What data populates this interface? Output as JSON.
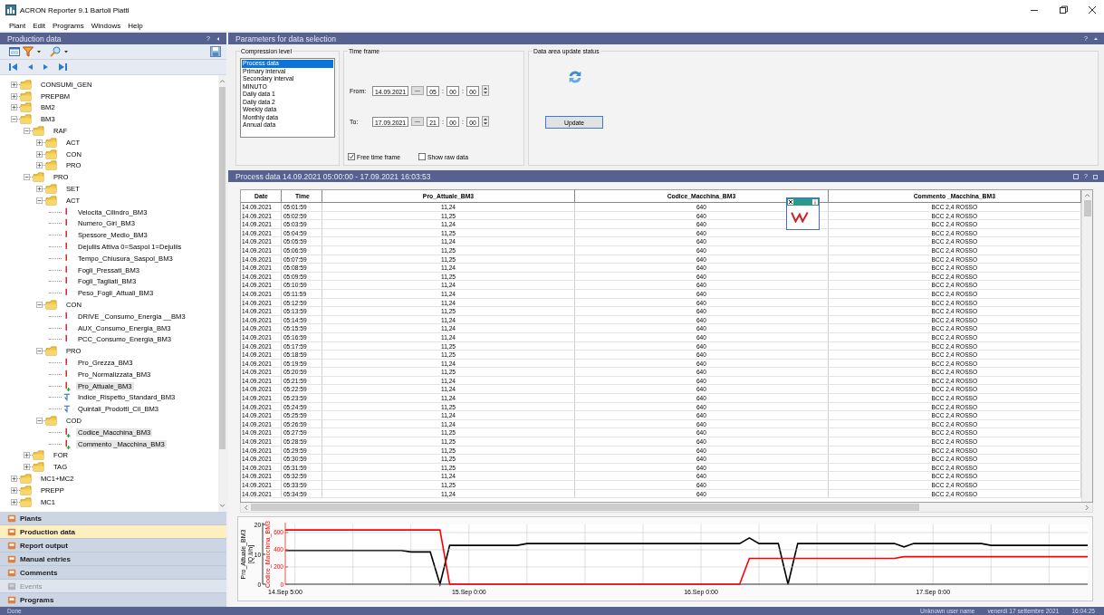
{
  "window": {
    "title": "ACRON  Reporter 9.1 Bartoli Piatti"
  },
  "menu": [
    "Plant",
    "Edit",
    "Programs",
    "Windows",
    "Help"
  ],
  "left_panel": {
    "title": "Production data",
    "help": "?",
    "tree": [
      {
        "label": "CONSUMI_GEN",
        "kind": "folder",
        "expanded": false,
        "selected": false
      },
      {
        "label": "PREPBM",
        "kind": "folder",
        "expanded": false,
        "selected": false
      },
      {
        "label": "BM2",
        "kind": "folder",
        "expanded": false,
        "selected": false
      },
      {
        "label": "BM3",
        "kind": "folder",
        "expanded": true,
        "selected": false,
        "children": [
          {
            "label": "RAF",
            "kind": "folder",
            "expanded": true,
            "selected": false,
            "children": [
              {
                "label": "ACT",
                "kind": "folder",
                "expanded": false,
                "selected": false
              },
              {
                "label": "CON",
                "kind": "folder",
                "expanded": false,
                "selected": false
              },
              {
                "label": "PRO",
                "kind": "folder",
                "expanded": false,
                "selected": false
              }
            ]
          },
          {
            "label": "PRO",
            "kind": "folder",
            "expanded": true,
            "selected": false,
            "children": [
              {
                "label": "SET",
                "kind": "folder",
                "expanded": false,
                "selected": false
              },
              {
                "label": "ACT",
                "kind": "folder",
                "expanded": true,
                "selected": false,
                "children": [
                  {
                    "label": "Velocita_Cilindro_BM3",
                    "kind": "signal",
                    "selected": false
                  },
                  {
                    "label": "Numero_Giri_BM3",
                    "kind": "signal",
                    "selected": false
                  },
                  {
                    "label": "Spessore_Medio_BM3",
                    "kind": "signal",
                    "selected": false
                  },
                  {
                    "label": "Dejuliis Attiva 0=Saspol 1=Dejuliis",
                    "kind": "signal",
                    "selected": false
                  },
                  {
                    "label": "Tempo_Chiusura_Saspol_BM3",
                    "kind": "signal",
                    "selected": false
                  },
                  {
                    "label": "Fogli_Pressati_BM3",
                    "kind": "signal",
                    "selected": false
                  },
                  {
                    "label": "Fogli_Tagliati_BM3",
                    "kind": "signal",
                    "selected": false
                  },
                  {
                    "label": "Peso_Fogli_Attuali_BM3",
                    "kind": "signal",
                    "selected": false
                  }
                ]
              },
              {
                "label": "CON",
                "kind": "folder",
                "expanded": true,
                "selected": false,
                "children": [
                  {
                    "label": "DRIVE _Consumo_Energia __BM3",
                    "kind": "signal",
                    "selected": false
                  },
                  {
                    "label": "AUX_Consumo_Energia_BM3",
                    "kind": "signal",
                    "selected": false
                  },
                  {
                    "label": "PCC_Consumo_Energia_BM3",
                    "kind": "signal",
                    "selected": false
                  }
                ]
              },
              {
                "label": "PRO",
                "kind": "folder",
                "expanded": true,
                "selected": false,
                "children": [
                  {
                    "label": "Pro_Grezza_BM3",
                    "kind": "signal",
                    "selected": false
                  },
                  {
                    "label": "Pro_Normalizzata_BM3",
                    "kind": "signal",
                    "selected": false
                  },
                  {
                    "label": "Pro_Attuale_BM3",
                    "kind": "signal",
                    "selected": true
                  },
                  {
                    "label": "Indice_Rispetto_Standard_BM3",
                    "kind": "formula",
                    "selected": false
                  },
                  {
                    "label": "Quintali_Prodotti_Cil_BM3",
                    "kind": "formula",
                    "selected": false
                  }
                ]
              },
              {
                "label": "COD",
                "kind": "folder",
                "expanded": true,
                "selected": false,
                "children": [
                  {
                    "label": "Codice_Macchina_BM3",
                    "kind": "signal",
                    "selected": true
                  },
                  {
                    "label": "Commento _Macchina_BM3",
                    "kind": "signal",
                    "selected": true
                  }
                ]
              }
            ]
          },
          {
            "label": "FOR",
            "kind": "folder",
            "expanded": false,
            "selected": false
          },
          {
            "label": "TAG",
            "kind": "folder",
            "expanded": false,
            "selected": false
          }
        ]
      },
      {
        "label": "MC1+MC2",
        "kind": "folder",
        "expanded": false,
        "selected": false
      },
      {
        "label": "PREPP",
        "kind": "folder",
        "expanded": false,
        "selected": false
      },
      {
        "label": "MC1",
        "kind": "folder",
        "expanded": false,
        "selected": false
      }
    ],
    "nav": [
      {
        "label": "Plants",
        "selected": false,
        "disabled": false
      },
      {
        "label": "Production data",
        "selected": true,
        "disabled": false
      },
      {
        "label": "Report output",
        "selected": false,
        "disabled": false
      },
      {
        "label": "Manual entries",
        "selected": false,
        "disabled": false
      },
      {
        "label": "Comments",
        "selected": false,
        "disabled": false
      },
      {
        "label": "Events",
        "selected": false,
        "disabled": true
      },
      {
        "label": "Programs",
        "selected": false,
        "disabled": false
      }
    ]
  },
  "parameters": {
    "title": "Parameters for data selection",
    "help": "?",
    "compression": {
      "legend": "Compression level",
      "options": [
        {
          "label": "Process data",
          "selected": true
        },
        {
          "label": "Primary interval",
          "selected": false
        },
        {
          "label": "Secondary interval",
          "selected": false
        },
        {
          "label": "MINUTO",
          "selected": false
        },
        {
          "label": "Daily data 1",
          "selected": false
        },
        {
          "label": "Daily data 2",
          "selected": false
        },
        {
          "label": "Weekly data",
          "selected": false
        },
        {
          "label": "Monthly data",
          "selected": false
        },
        {
          "label": "Annual data",
          "selected": false
        }
      ]
    },
    "time_frame": {
      "legend": "Time frame",
      "ranges": [
        {
          "label": "From:",
          "date": "14.09.2021",
          "browse": "---",
          "hh": "05",
          "mm": "00",
          "ss": "00",
          "separator": ":"
        },
        {
          "label": "To:",
          "date": "17.09.2021",
          "browse": "---",
          "hh": "21",
          "mm": "00",
          "ss": "00",
          "separator": ":"
        }
      ],
      "options": [
        {
          "label": "Free time frame",
          "checked": true
        },
        {
          "label": "Show raw data",
          "checked": false
        }
      ]
    },
    "update_status": {
      "legend": "Data area update status",
      "button": "Update"
    }
  },
  "process_data": {
    "title": "Process data  14.09.2021 05:00:00 - 17.09.2021 16:03:53",
    "columns": [
      "Date",
      "Time",
      "Pro_Attuale_BM3",
      "Codice_Macchina_BM3",
      "Commento _Macchina_BM3"
    ],
    "rows": [
      [
        "14.09.2021",
        "05:01:59",
        "11,24",
        "640",
        "BCC 2,4 ROSSO"
      ],
      [
        "14.09.2021",
        "05:02:59",
        "11,25",
        "640",
        "BCC 2,4 ROSSO"
      ],
      [
        "14.09.2021",
        "05:03:59",
        "11,24",
        "640",
        "BCC 2,4 ROSSO"
      ],
      [
        "14.09.2021",
        "05:04:59",
        "11,25",
        "640",
        "BCC 2,4 ROSSO"
      ],
      [
        "14.09.2021",
        "05:05:59",
        "11,24",
        "640",
        "BCC 2,4 ROSSO"
      ],
      [
        "14.09.2021",
        "05:06:59",
        "11,25",
        "640",
        "BCC 2,4 ROSSO"
      ],
      [
        "14.09.2021",
        "05:07:59",
        "11,25",
        "640",
        "BCC 2,4 ROSSO"
      ],
      [
        "14.09.2021",
        "05:08:59",
        "11,24",
        "640",
        "BCC 2,4 ROSSO"
      ],
      [
        "14.09.2021",
        "05:09:59",
        "11,25",
        "640",
        "BCC 2,4 ROSSO"
      ],
      [
        "14.09.2021",
        "05:10:59",
        "11,24",
        "640",
        "BCC 2,4 ROSSO"
      ],
      [
        "14.09.2021",
        "05:11:59",
        "11,24",
        "640",
        "BCC 2,4 ROSSO"
      ],
      [
        "14.09.2021",
        "05:12:59",
        "11,24",
        "640",
        "BCC 2,4 ROSSO"
      ],
      [
        "14.09.2021",
        "05:13:59",
        "11,25",
        "640",
        "BCC 2,4 ROSSO"
      ],
      [
        "14.09.2021",
        "05:14:59",
        "11,24",
        "640",
        "BCC 2,4 ROSSO"
      ],
      [
        "14.09.2021",
        "05:15:59",
        "11,24",
        "640",
        "BCC 2,4 ROSSO"
      ],
      [
        "14.09.2021",
        "05:16:59",
        "11,24",
        "640",
        "BCC 2,4 ROSSO"
      ],
      [
        "14.09.2021",
        "05:17:59",
        "11,25",
        "640",
        "BCC 2,4 ROSSO"
      ],
      [
        "14.09.2021",
        "05:18:59",
        "11,25",
        "640",
        "BCC 2,4 ROSSO"
      ],
      [
        "14.09.2021",
        "05:19:59",
        "11,24",
        "640",
        "BCC 2,4 ROSSO"
      ],
      [
        "14.09.2021",
        "05:20:59",
        "11,25",
        "640",
        "BCC 2,4 ROSSO"
      ],
      [
        "14.09.2021",
        "05:21:59",
        "11,24",
        "640",
        "BCC 2,4 ROSSO"
      ],
      [
        "14.09.2021",
        "05:22:59",
        "11,24",
        "640",
        "BCC 2,4 ROSSO"
      ],
      [
        "14.09.2021",
        "05:23:59",
        "11,24",
        "640",
        "BCC 2,4 ROSSO"
      ],
      [
        "14.09.2021",
        "05:24:59",
        "11,25",
        "640",
        "BCC 2,4 ROSSO"
      ],
      [
        "14.09.2021",
        "05:25:59",
        "11,24",
        "640",
        "BCC 2,4 ROSSO"
      ],
      [
        "14.09.2021",
        "05:26:59",
        "11,24",
        "640",
        "BCC 2,4 ROSSO"
      ],
      [
        "14.09.2021",
        "05:27:59",
        "11,25",
        "640",
        "BCC 2,4 ROSSO"
      ],
      [
        "14.09.2021",
        "05:28:59",
        "11,25",
        "640",
        "BCC 2,4 ROSSO"
      ],
      [
        "14.09.2021",
        "05:29:59",
        "11,25",
        "640",
        "BCC 2,4 ROSSO"
      ],
      [
        "14.09.2021",
        "05:30:59",
        "11,25",
        "640",
        "BCC 2,4 ROSSO"
      ],
      [
        "14.09.2021",
        "05:31:59",
        "11,25",
        "640",
        "BCC 2,4 ROSSO"
      ],
      [
        "14.09.2021",
        "05:32:59",
        "11,24",
        "640",
        "BCC 2,4 ROSSO"
      ],
      [
        "14.09.2021",
        "05:33:59",
        "11,25",
        "640",
        "BCC 2,4 ROSSO"
      ],
      [
        "14.09.2021",
        "05:34:59",
        "11,24",
        "640",
        "BCC 2,4 ROSSO"
      ]
    ],
    "trends": [
      {
        "chart_data": {
          "type": "line",
          "grid": true,
          "categories": [
            "14.Sep 5:00",
            null,
            null,
            null,
            null,
            null,
            null,
            null,
            null,
            null,
            null,
            null,
            null,
            null,
            null,
            null,
            null,
            null,
            null,
            "15.Sep 0:00",
            null,
            null,
            null,
            null,
            null,
            null,
            null,
            null,
            null,
            null,
            null,
            null,
            null,
            null,
            null,
            null,
            null,
            null,
            null,
            null,
            null,
            null,
            null,
            "16.Sep 0:00",
            null,
            null,
            null,
            null,
            null,
            null,
            null,
            null,
            null,
            null,
            null,
            null,
            null,
            null,
            null,
            null,
            null,
            null,
            null,
            null,
            null,
            null,
            null,
            "17.Sep 0:00",
            null,
            null,
            null,
            null,
            null,
            null,
            null,
            null,
            null,
            null,
            null,
            null,
            null,
            null,
            null,
            null
          ],
          "ylim": [
            0,
            20
          ],
          "yticks": [
            0,
            10,
            20
          ],
          "series": [
            {
              "name": "Pro_Attuale_BM3 [Q.li/h]",
              "color": "#000000",
              "values": [
                11.3,
                11.3,
                11.3,
                11.3,
                11.3,
                11.3,
                11.3,
                11.3,
                11.3,
                11.3,
                11.3,
                11.3,
                11.3,
                10.8,
                10.8,
                10.8,
                0,
                13,
                13,
                13,
                13,
                13,
                13,
                13,
                13,
                13.6,
                13.6,
                13.6,
                13.6,
                13.6,
                13.6,
                13.6,
                13.6,
                13.6,
                13.6,
                13.6,
                13.6,
                13.6,
                13.6,
                13.6,
                13.6,
                13.6,
                13.6,
                13.6,
                13.6,
                13.6,
                13.6,
                13.6,
                15.5,
                13.6,
                13.6,
                13.6,
                0,
                13.6,
                13.6,
                13.6,
                13.6,
                13.6,
                13.6,
                13.6,
                13.6,
                13.6,
                13.6,
                13.6,
                12.5,
                13.6,
                13.6,
                13.6,
                13.6,
                13.6,
                13.6,
                13.6,
                13.6,
                13,
                13,
                13,
                13,
                13,
                13,
                13,
                13,
                13,
                13,
                13
              ]
            }
          ]
        }
      },
      {
        "chart_data": {
          "type": "line",
          "grid": true,
          "categories": [
            null,
            null,
            null,
            null,
            null,
            null,
            null,
            null,
            null,
            null,
            null,
            null,
            null,
            null,
            null,
            null,
            null,
            null,
            null,
            null,
            null,
            null,
            null,
            null,
            null,
            null,
            null,
            null,
            null,
            null,
            null,
            null,
            null,
            null,
            null,
            null,
            null,
            null,
            null,
            null,
            null,
            null,
            null,
            null,
            null,
            null,
            null,
            null,
            null,
            null,
            null,
            null,
            null,
            null,
            null,
            null,
            null,
            null,
            null,
            null,
            null,
            null,
            null,
            null,
            null,
            null,
            null,
            null,
            null,
            null,
            null,
            null,
            null,
            null,
            null,
            null,
            null,
            null,
            null,
            null,
            null,
            null,
            null,
            null
          ],
          "ylim": [
            0,
            694
          ],
          "yticks": [
            0,
            200,
            400,
            600
          ],
          "series": [
            {
              "name": "Codice_Macchina_BM3",
              "color": "#ff0000",
              "values": [
                630,
                630,
                630,
                630,
                630,
                630,
                630,
                630,
                630,
                630,
                630,
                630,
                630,
                630,
                630,
                630,
                630,
                0,
                0,
                0,
                0,
                0,
                0,
                0,
                0,
                0,
                0,
                0,
                0,
                0,
                0,
                0,
                0,
                0,
                0,
                0,
                0,
                0,
                0,
                0,
                0,
                0,
                0,
                0,
                0,
                0,
                0,
                0,
                300,
                300,
                300,
                300,
                300,
                300,
                300,
                300,
                300,
                300,
                300,
                300,
                300,
                300,
                300,
                300,
                320,
                320,
                320,
                320,
                320,
                320,
                320,
                320,
                320,
                320,
                320,
                320,
                320,
                320,
                320,
                320,
                320,
                320,
                320,
                320
              ]
            }
          ]
        }
      }
    ]
  },
  "status_bar": {
    "state": "Done",
    "user": "Unknown user name",
    "date": "venerdì 17 settembre 2021",
    "time": "16:04:25"
  }
}
